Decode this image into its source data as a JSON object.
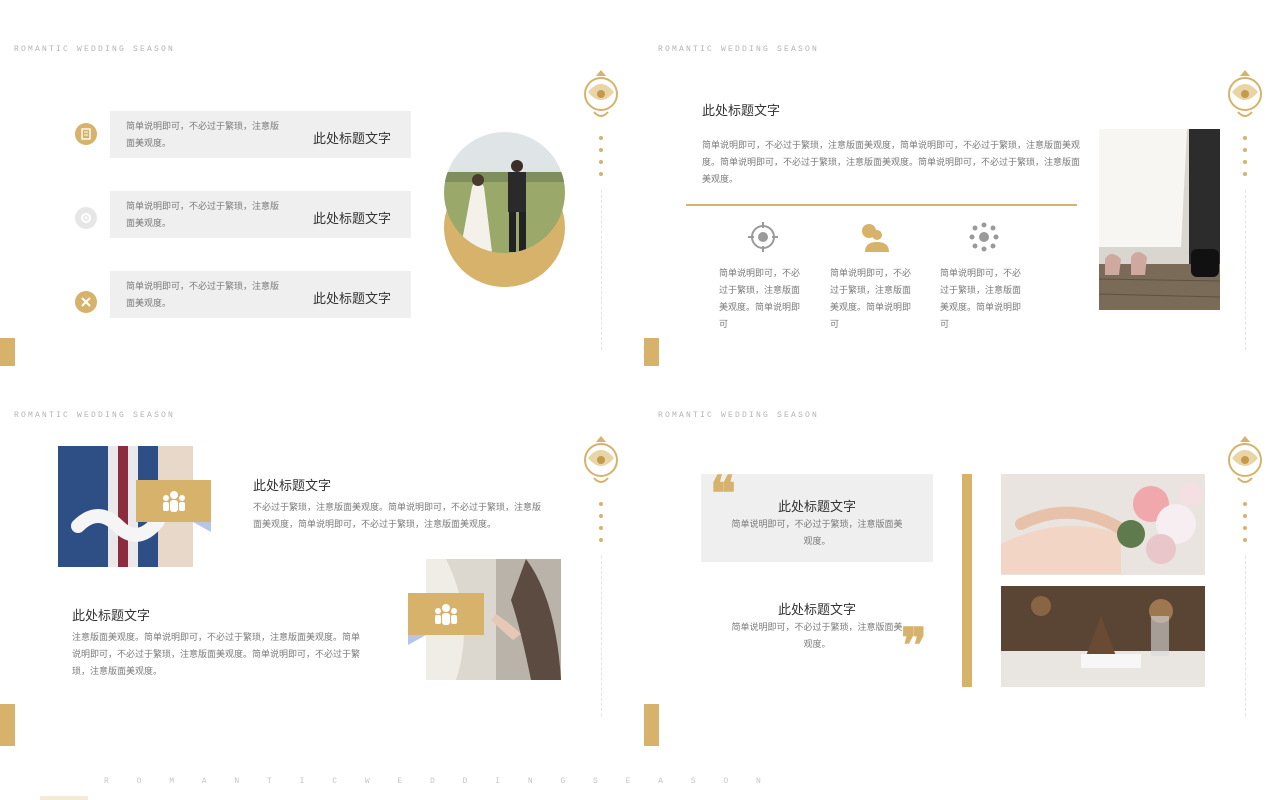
{
  "brand": "ROMANTIC WEDDING SEASON",
  "brand_bottom": "R O M A N T I C   W E D D I N G   S E A S O N",
  "colors": {
    "accent": "#d6b26a",
    "panel": "#efefef",
    "muted_text": "#7a7a7a",
    "blue_accent": "#b7c6e6"
  },
  "slide1": {
    "rows": [
      {
        "icon": "document-icon",
        "desc": "简单说明即可，不必过于繁琐，注意版面美观度。",
        "title": "此处标题文字"
      },
      {
        "icon": "gear-icon",
        "desc": "简单说明即可，不必过于繁琐，注意版面美观度。",
        "title": "此处标题文字"
      },
      {
        "icon": "tools-icon",
        "desc": "简单说明即可，不必过于繁琐，注意版面美观度。",
        "title": "此处标题文字"
      }
    ],
    "photo": "wedding-couple-walking-photo"
  },
  "slide2": {
    "title": "此处标题文字",
    "paragraph": "简单说明即可，不必过于繁琐，注意版面美观度，简单说明即可，不必过于繁琐，注意版面美观度。简单说明即可，不必过于繁琐，注意版面美观度。简单说明即可，不必过于繁琐，注意版面美观度。",
    "columns": [
      {
        "icon": "target-icon",
        "text": "简单说明即可，不必过于繁琐，注意版面美观度。简单说明即可"
      },
      {
        "icon": "money-person-icon",
        "text": "简单说明即可，不必过于繁琐，注意版面美观度。简单说明即可"
      },
      {
        "icon": "network-icon",
        "text": "简单说明即可，不必过于繁琐，注意版面美观度。简单说明即可"
      }
    ],
    "photo": "bride-groom-feet-photo"
  },
  "slide3": {
    "block_a": {
      "title": "此处标题文字",
      "text": "不必过于繁琐，注意版面美观度。简单说明即可，不必过于繁琐，注意版面美观度，简单说明即可，不必过于繁琐，注意版面美观度。"
    },
    "block_b": {
      "title": "此处标题文字",
      "text": "注意版面美观度。简单说明即可，不必过于繁琐，注意版面美观度。简单说明即可，不必过于繁琐，注意版面美观度。简单说明即可，不必过于繁琐，注意版面美观度。"
    },
    "photo_a": "groom-holding-letters-photo",
    "photo_b": "holding-hands-photo",
    "box_icon": "people-group-icon"
  },
  "slide4": {
    "quote1": {
      "title": "此处标题文字",
      "text": "简单说明即可，不必过于繁琐，注意版面美观度。"
    },
    "quote2": {
      "title": "此处标题文字",
      "text": "简单说明即可，不必过于繁琐，注意版面美观度。"
    },
    "open_quote": "❝",
    "close_quote": "❞",
    "photo_c": "ring-bouquet-photo",
    "photo_d": "table-setting-pinecone-photo"
  }
}
